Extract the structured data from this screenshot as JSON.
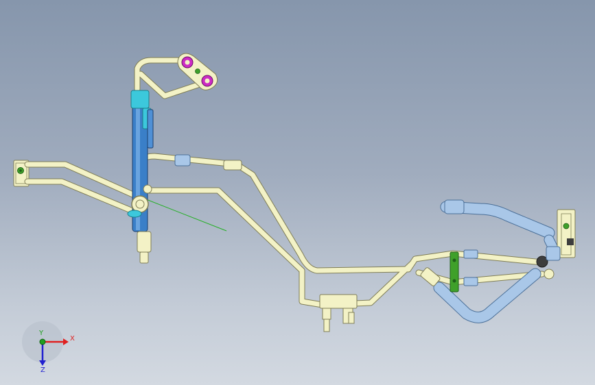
{
  "viewport": {
    "background_top": "#8696ac",
    "background_bottom": "#d3d9e1"
  },
  "triad": {
    "x_label": "X",
    "y_label": "Y",
    "z_label": "Z",
    "x_color": "#e02020",
    "y_color": "#20a020",
    "z_color": "#2020d0"
  },
  "colors": {
    "tube_fill": "#f3f2c6",
    "tube_edge": "#7f7d55",
    "hose_blue": "#3a7fc8",
    "sleeve_cyan": "#3cc8dc",
    "hose_lightblue": "#a9c7e8",
    "flange_magenta": "#cc2ac4",
    "clamp_green": "#3fa02a",
    "dark_fitting": "#3d3d3d",
    "axis_line": "#22b022"
  }
}
